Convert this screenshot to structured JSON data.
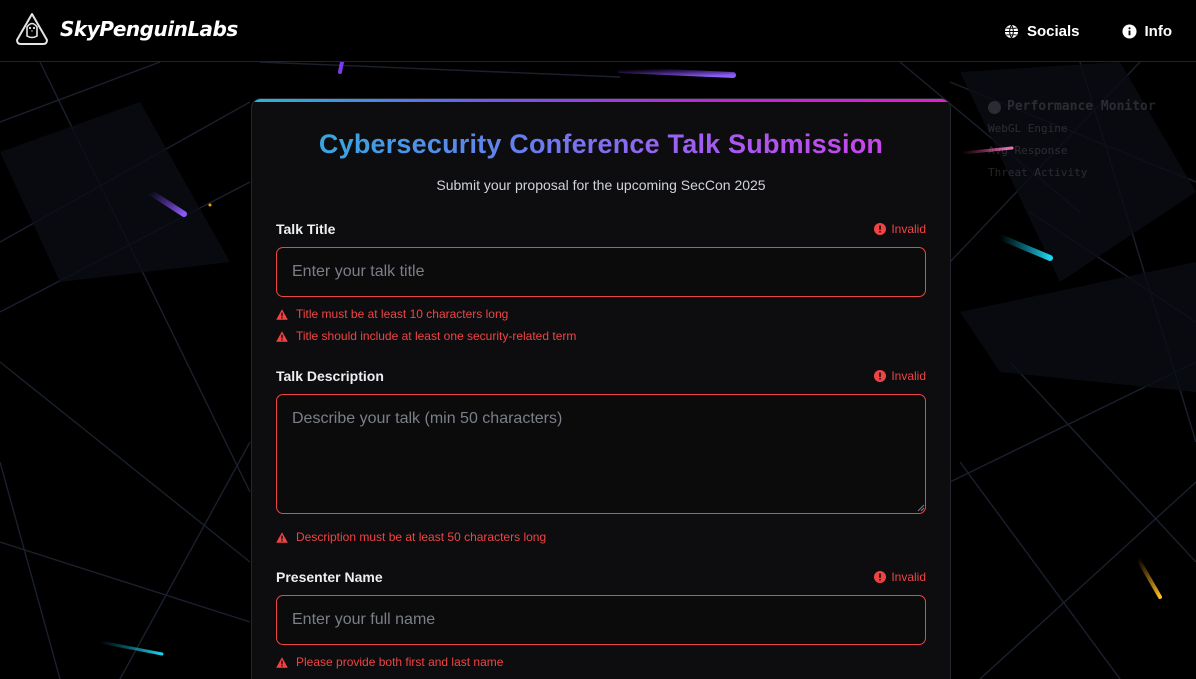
{
  "nav": {
    "brand": "SkyPenguinLabs",
    "links": [
      {
        "label": "Socials",
        "icon": "globe-icon"
      },
      {
        "label": "Info",
        "icon": "info-icon"
      }
    ]
  },
  "perf_monitor": {
    "title": "Performance Monitor",
    "lines": [
      "WebGL Engine",
      "Avg Response",
      "Threat Activity"
    ]
  },
  "form": {
    "title": "Cybersecurity Conference Talk Submission",
    "subtitle": "Submit your proposal for the upcoming SecCon 2025",
    "fields": [
      {
        "label": "Talk Title",
        "status": "Invalid",
        "value": "",
        "placeholder": "Enter your talk title",
        "errors": [
          "Title must be at least 10 characters long",
          "Title should include at least one security-related term"
        ]
      },
      {
        "label": "Talk Description",
        "status": "Invalid",
        "value": "",
        "placeholder": "Describe your talk (min 50 characters)",
        "errors": [
          "Description must be at least 50 characters long"
        ]
      },
      {
        "label": "Presenter Name",
        "status": "Invalid",
        "value": "",
        "placeholder": "Enter your full name",
        "errors": [
          "Please provide both first and last name"
        ]
      }
    ]
  },
  "colors": {
    "error": "#ef4444",
    "accent_start": "#22b8d8",
    "accent_end": "#e11fd0",
    "background": "#000000",
    "card": "#0d0d0f"
  }
}
